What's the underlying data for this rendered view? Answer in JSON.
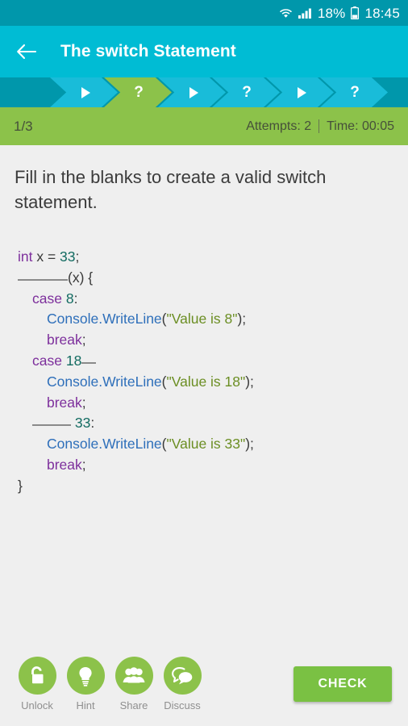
{
  "statusbar": {
    "wifi_icon": "wifi-icon",
    "signal_icon": "signal-bars-icon",
    "battery_text": "18%",
    "battery_icon": "battery-icon",
    "time": "18:45"
  },
  "appbar": {
    "back_icon": "back-arrow-icon",
    "title": "The switch Statement"
  },
  "progress": {
    "steps": [
      {
        "type": "play",
        "state": "done",
        "icon": "play-triangle-icon"
      },
      {
        "type": "question",
        "state": "active",
        "label": "?"
      },
      {
        "type": "play",
        "state": "upcoming",
        "icon": "play-triangle-icon"
      },
      {
        "type": "question",
        "state": "upcoming",
        "label": "?"
      },
      {
        "type": "play",
        "state": "upcoming",
        "icon": "play-triangle-icon"
      },
      {
        "type": "question",
        "state": "upcoming",
        "label": "?"
      }
    ]
  },
  "infobar": {
    "page": "1/3",
    "attempts": "Attempts: 2",
    "time": "Time: 00:05"
  },
  "main": {
    "question": "Fill in the blanks to create a valid switch statement.",
    "code_lines": [
      {
        "indent": 0,
        "tokens": [
          {
            "t": "kw",
            "v": "int"
          },
          {
            "t": "punc",
            "v": " x = "
          },
          {
            "t": "num",
            "v": "33"
          },
          {
            "t": "punc",
            "v": ";"
          }
        ]
      },
      {
        "indent": 0,
        "tokens": [
          {
            "t": "blank-long",
            "v": ""
          },
          {
            "t": "punc",
            "v": "(x) {"
          }
        ]
      },
      {
        "indent": 1,
        "tokens": [
          {
            "t": "kw",
            "v": "case"
          },
          {
            "t": "punc",
            "v": " "
          },
          {
            "t": "num",
            "v": "8"
          },
          {
            "t": "punc",
            "v": ":"
          }
        ]
      },
      {
        "indent": 2,
        "tokens": [
          {
            "t": "fn",
            "v": "Console.WriteLine"
          },
          {
            "t": "punc",
            "v": "("
          },
          {
            "t": "str",
            "v": "\"Value is 8\""
          },
          {
            "t": "punc",
            "v": ");"
          }
        ]
      },
      {
        "indent": 2,
        "tokens": [
          {
            "t": "kw",
            "v": "break"
          },
          {
            "t": "punc",
            "v": ";"
          }
        ]
      },
      {
        "indent": 1,
        "tokens": [
          {
            "t": "kw",
            "v": "case"
          },
          {
            "t": "punc",
            "v": " "
          },
          {
            "t": "num",
            "v": "18"
          },
          {
            "t": "blank-tiny",
            "v": ""
          }
        ]
      },
      {
        "indent": 2,
        "tokens": [
          {
            "t": "fn",
            "v": "Console.WriteLine"
          },
          {
            "t": "punc",
            "v": "("
          },
          {
            "t": "str",
            "v": "\"Value is 18\""
          },
          {
            "t": "punc",
            "v": ");"
          }
        ]
      },
      {
        "indent": 2,
        "tokens": [
          {
            "t": "kw",
            "v": "break"
          },
          {
            "t": "punc",
            "v": ";"
          }
        ]
      },
      {
        "indent": 1,
        "tokens": [
          {
            "t": "blank-short",
            "v": ""
          },
          {
            "t": "punc",
            "v": " "
          },
          {
            "t": "num",
            "v": "33"
          },
          {
            "t": "punc",
            "v": ":"
          }
        ]
      },
      {
        "indent": 2,
        "tokens": [
          {
            "t": "fn",
            "v": "Console.WriteLine"
          },
          {
            "t": "punc",
            "v": "("
          },
          {
            "t": "str",
            "v": "\"Value is 33\""
          },
          {
            "t": "punc",
            "v": ");"
          }
        ]
      },
      {
        "indent": 2,
        "tokens": [
          {
            "t": "kw",
            "v": "break"
          },
          {
            "t": "punc",
            "v": ";"
          }
        ]
      },
      {
        "indent": 0,
        "tokens": [
          {
            "t": "punc",
            "v": "}"
          }
        ]
      }
    ]
  },
  "bottom": {
    "tools": [
      {
        "label": "Unlock",
        "icon": "unlock-padlock-icon"
      },
      {
        "label": "Hint",
        "icon": "lightbulb-icon"
      },
      {
        "label": "Share",
        "icon": "people-group-icon"
      },
      {
        "label": "Discuss",
        "icon": "speech-bubbles-icon"
      }
    ],
    "check_label": "CHECK"
  },
  "colors": {
    "status_bar": "#0097ab",
    "app_bar": "#00bcd4",
    "chevron_cyan": "#19bcd9",
    "chevron_green": "#8cc24a",
    "info_bar": "#8cc24a",
    "accent_green": "#7ac143",
    "content_bg": "#efefef"
  }
}
